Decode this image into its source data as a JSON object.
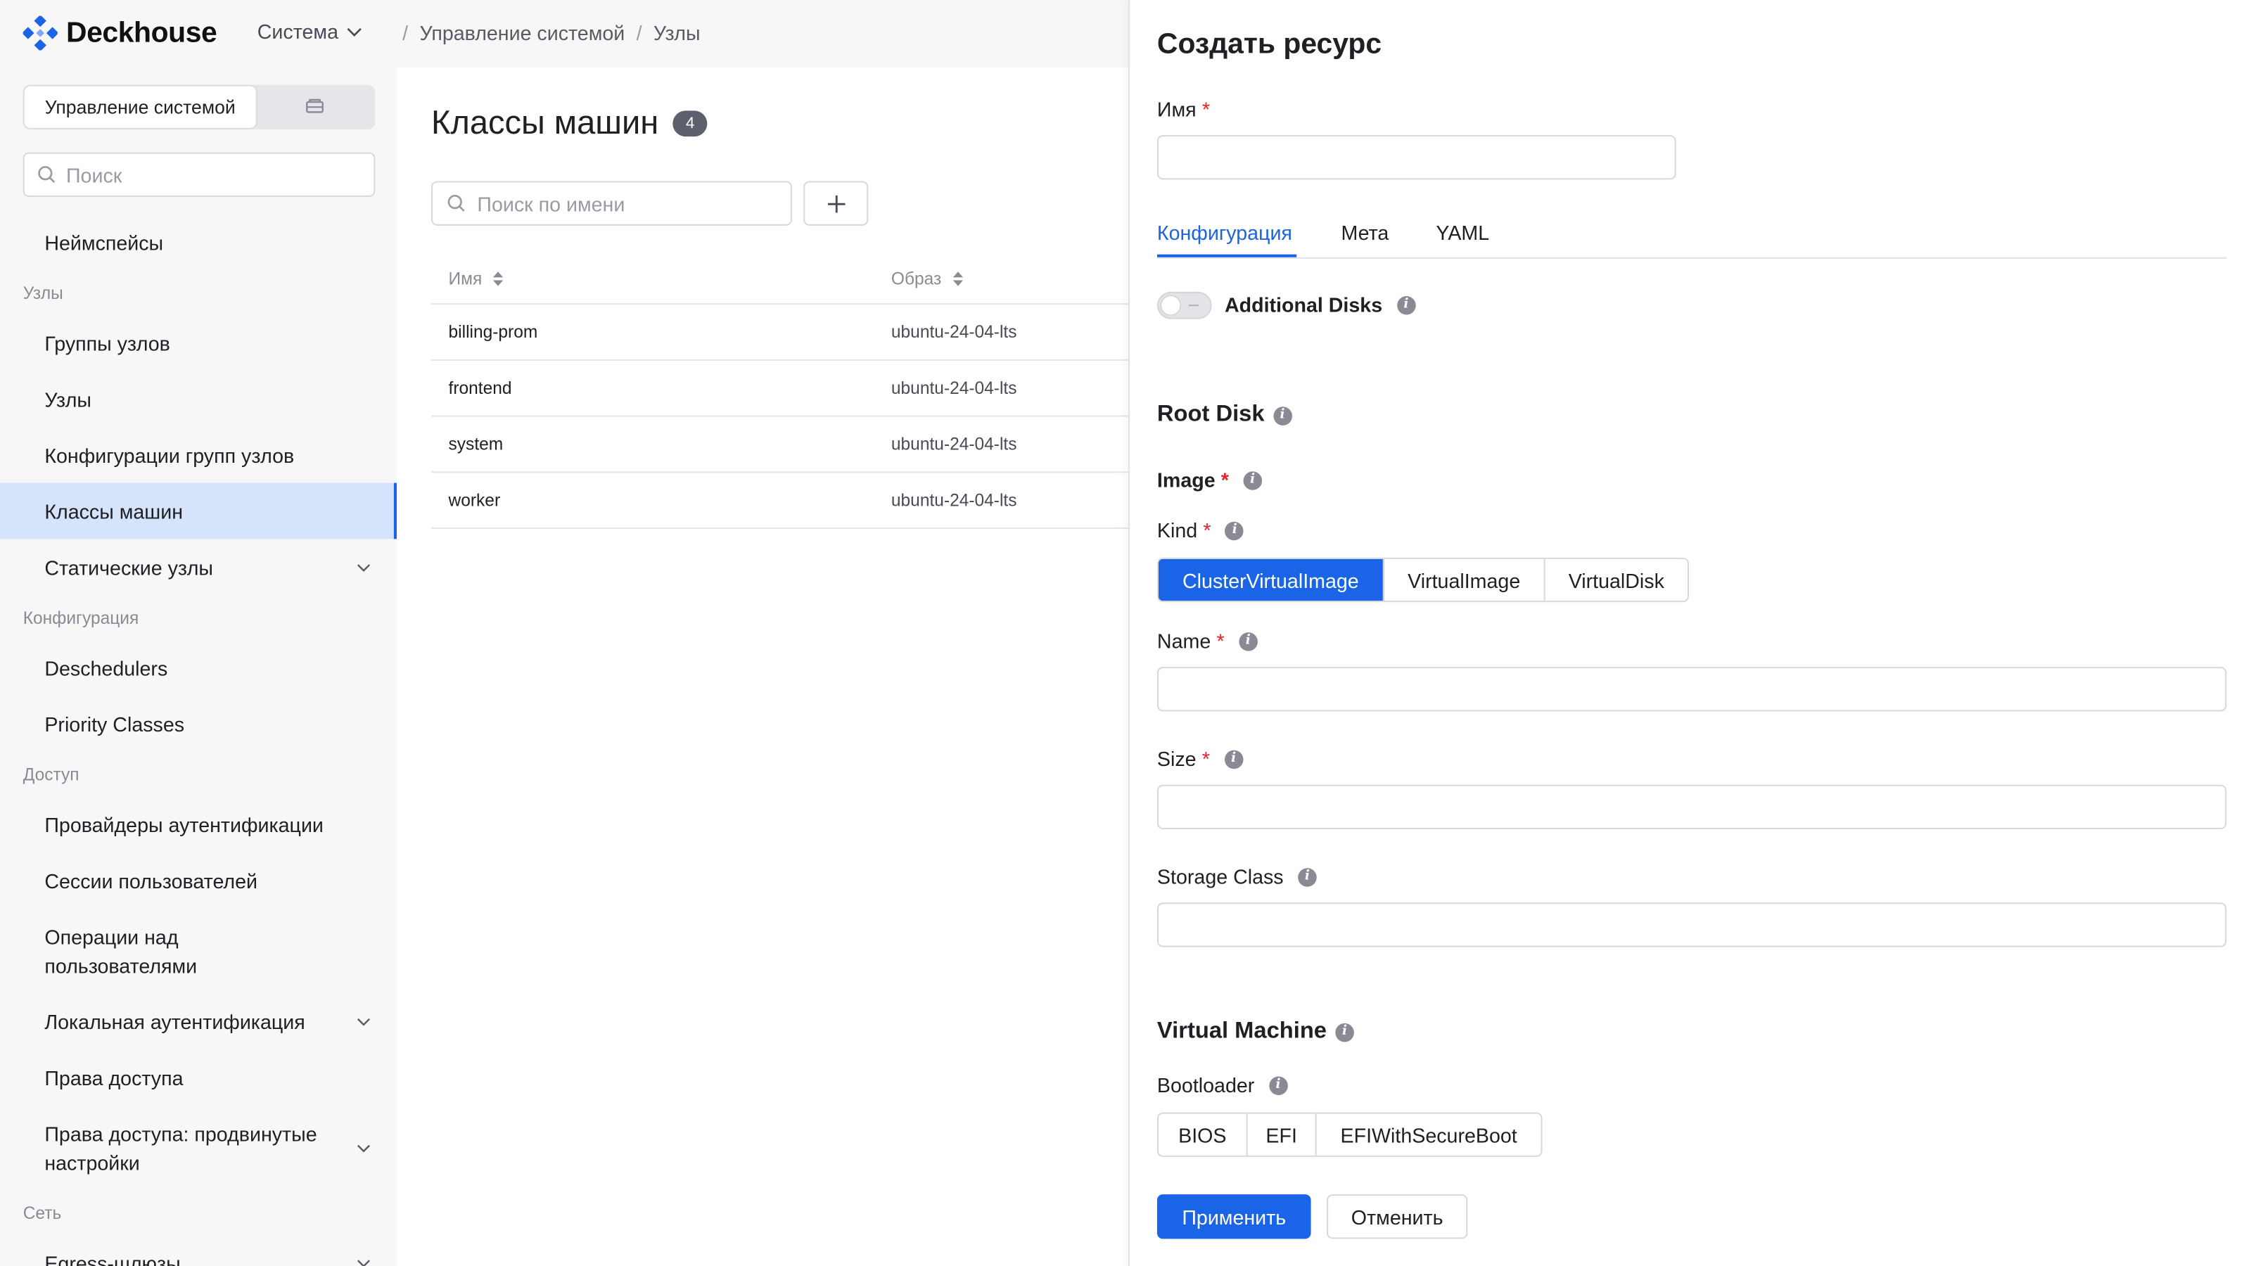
{
  "app": {
    "logo_text": "Deckhouse",
    "system_menu": "Система"
  },
  "sidebar": {
    "segment_active": "Управление системой",
    "search_placeholder": "Поиск",
    "items": [
      {
        "type": "item",
        "label": "Неймспейсы"
      },
      {
        "type": "section",
        "label": "Узлы"
      },
      {
        "type": "item",
        "label": "Группы узлов"
      },
      {
        "type": "item",
        "label": "Узлы"
      },
      {
        "type": "item",
        "label": "Конфигурации групп узлов"
      },
      {
        "type": "item",
        "label": "Классы машин",
        "active": true
      },
      {
        "type": "item",
        "label": "Статические узлы",
        "expandable": true
      },
      {
        "type": "section",
        "label": "Конфигурация"
      },
      {
        "type": "item",
        "label": "Deschedulers"
      },
      {
        "type": "item",
        "label": "Priority Classes"
      },
      {
        "type": "section",
        "label": "Доступ"
      },
      {
        "type": "item",
        "label": "Провайдеры аутентификации"
      },
      {
        "type": "item",
        "label": "Сессии пользователей"
      },
      {
        "type": "item",
        "label": "Операции над пользователями",
        "lines": [
          "Операции над",
          "пользователями"
        ]
      },
      {
        "type": "item",
        "label": "Локальная аутентификация",
        "expandable": true
      },
      {
        "type": "item",
        "label": "Права доступа"
      },
      {
        "type": "item",
        "label": "Права доступа: продвинутые настройки",
        "lines": [
          "Права доступа: продвинутые",
          "настройки"
        ],
        "expandable": true
      },
      {
        "type": "section",
        "label": "Сеть"
      },
      {
        "type": "item",
        "label": "Egress-шлюзы",
        "expandable": true
      }
    ]
  },
  "breadcrumbs": [
    "Управление системой",
    "Узлы"
  ],
  "main": {
    "title": "Классы машин",
    "count": "4",
    "search_placeholder": "Поиск по имени",
    "columns": [
      "Имя",
      "Образ"
    ],
    "rows": [
      {
        "name": "billing-prom",
        "image": "ubuntu-24-04-lts"
      },
      {
        "name": "frontend",
        "image": "ubuntu-24-04-lts"
      },
      {
        "name": "system",
        "image": "ubuntu-24-04-lts"
      },
      {
        "name": "worker",
        "image": "ubuntu-24-04-lts"
      }
    ]
  },
  "drawer": {
    "title": "Создать ресурс",
    "name_label": "Имя",
    "tabs": [
      "Конфигурация",
      "Мета",
      "YAML"
    ],
    "additional_disks_label": "Additional Disks",
    "root_disk_heading": "Root Disk",
    "image_label": "Image",
    "kind_label": "Kind",
    "kind_options": [
      "ClusterVirtualImage",
      "VirtualImage",
      "VirtualDisk"
    ],
    "kind_selected": "ClusterVirtualImage",
    "disk_name_label": "Name",
    "size_label": "Size",
    "storage_class_label": "Storage Class",
    "vm_heading": "Virtual Machine",
    "bootloader_label": "Bootloader",
    "bootloader_options": [
      "BIOS",
      "EFI",
      "EFIWithSecureBoot"
    ],
    "apply_button": "Применить",
    "cancel_button": "Отменить"
  },
  "colors": {
    "accent": "#1a64e8",
    "required": "#e5252a",
    "sidebar_bg": "#f7f7f8",
    "active_item_bg": "#d5e3fb"
  }
}
